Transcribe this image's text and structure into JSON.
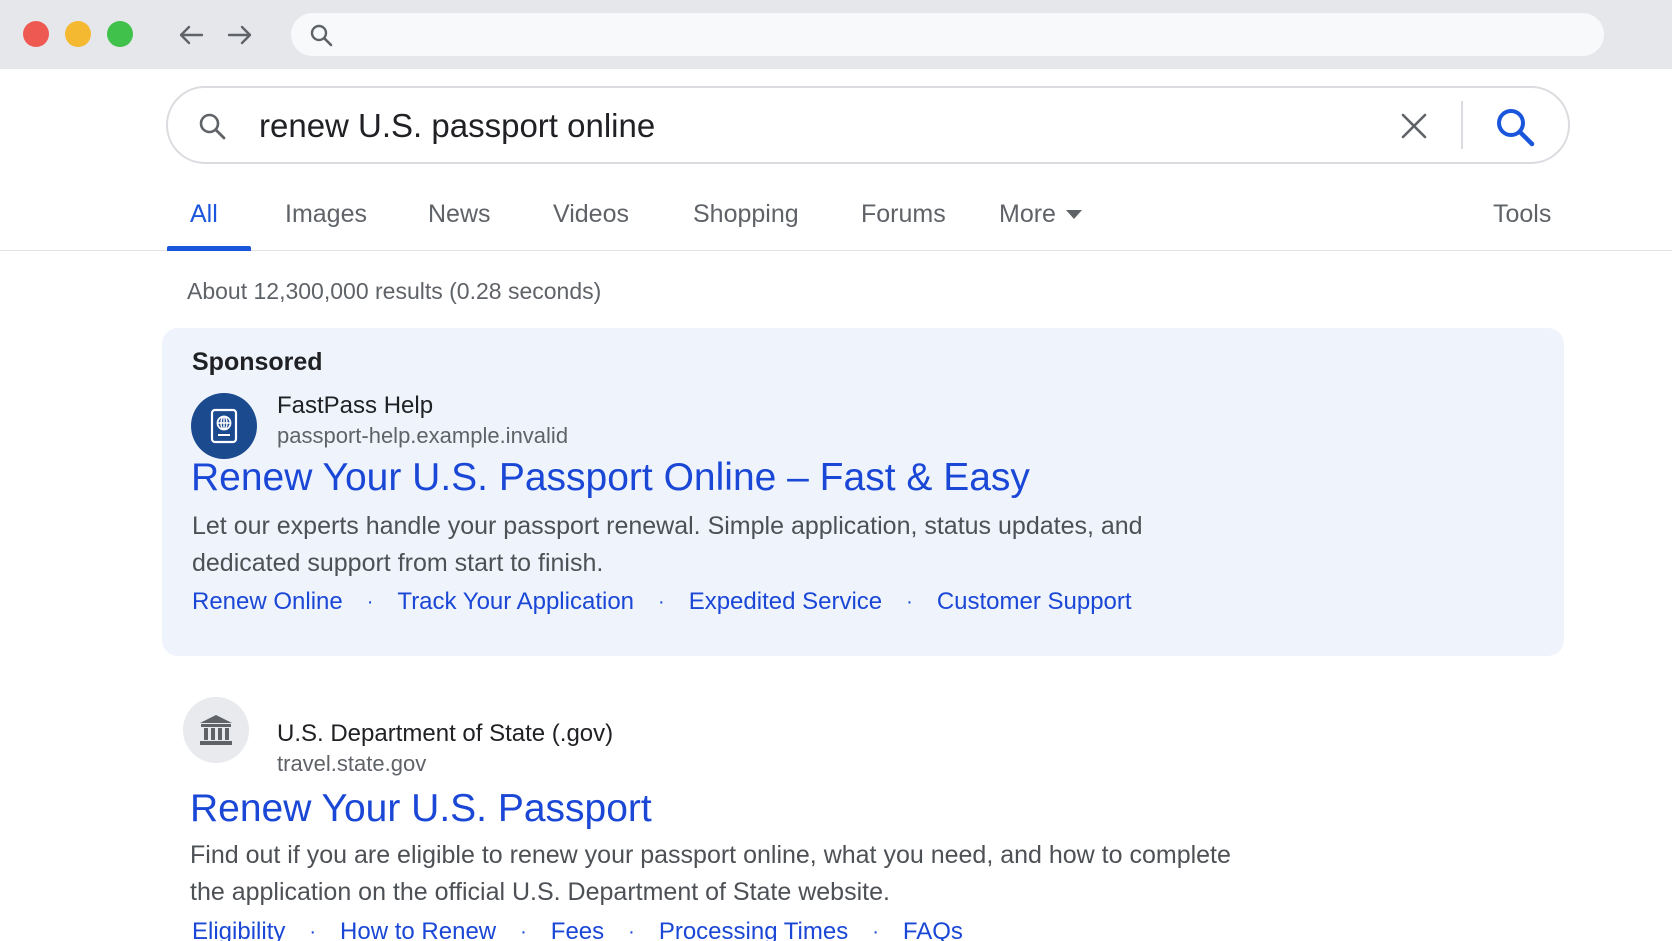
{
  "browser": {
    "address_value": ""
  },
  "search": {
    "query": "renew U.S. passport online"
  },
  "tabs": [
    {
      "label": "All",
      "active": true
    },
    {
      "label": "Images"
    },
    {
      "label": "News"
    },
    {
      "label": "Videos"
    },
    {
      "label": "Shopping"
    },
    {
      "label": "Forums"
    },
    {
      "label": "More"
    }
  ],
  "tools_label": "Tools",
  "stats": "About 12,300,000 results (0.28 seconds)",
  "ad": {
    "label": "Sponsored",
    "site_name": "FastPass Help",
    "site_url": "passport-help.example.invalid",
    "title": "Renew Your U.S. Passport Online – Fast & Easy",
    "snippet_line1": "Let our experts handle your passport renewal. Simple application, status updates, and",
    "snippet_line2": "dedicated support from start to finish.",
    "sitelinks": [
      "Renew Online",
      "Track Your Application",
      "Expedited Service",
      "Customer Support"
    ],
    "separator": "·",
    "icon": "passport-icon"
  },
  "organic": {
    "site_name": "U.S. Department of State (.gov)",
    "site_url": "travel.state.gov",
    "title": "Renew Your U.S. Passport",
    "snippet_line1": "Find out if you are eligible to renew your passport online, what you need, and how to complete",
    "snippet_line2": "the application on the official U.S. Department of State website.",
    "sitelinks": [
      "Eligibility",
      "How to Renew",
      "Fees",
      "Processing Times",
      "FAQs"
    ],
    "separator": "·",
    "icon": "government-building-icon"
  },
  "colors": {
    "link_blue": "#1a47d6",
    "ad_background": "#eff4fc",
    "ad_favicon": "#1b4a8f"
  }
}
